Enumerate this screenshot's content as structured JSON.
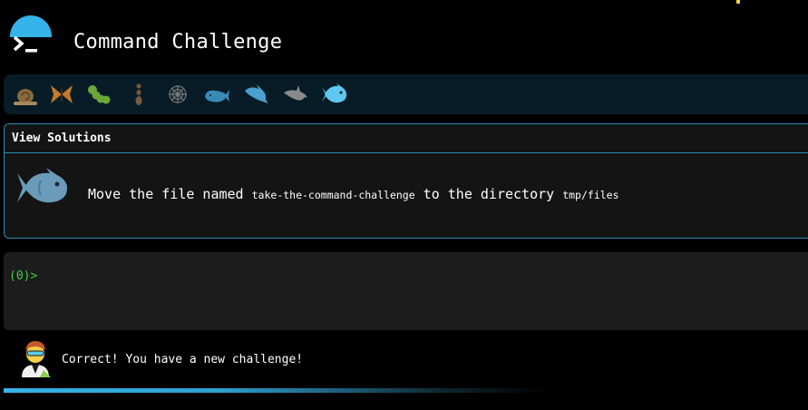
{
  "app": {
    "title": "Command Challenge"
  },
  "levels": [
    {
      "name": "snail-icon",
      "color": "#8a6a3a"
    },
    {
      "name": "butterfly-icon",
      "color": "#c47a2a"
    },
    {
      "name": "caterpillar-icon",
      "color": "#6aa83a"
    },
    {
      "name": "ant-icon",
      "color": "#7a5a3a"
    },
    {
      "name": "spiderweb-icon",
      "color": "#777777"
    },
    {
      "name": "whale-icon",
      "color": "#3a8ab8"
    },
    {
      "name": "dolphin-icon",
      "color": "#4aa0d0"
    },
    {
      "name": "dolphin-grey-icon",
      "color": "#8a8a8a"
    },
    {
      "name": "fish-icon",
      "color": "#5ec8f0"
    }
  ],
  "card": {
    "view_solutions": "View Solutions",
    "challenge": {
      "prefix": "Move the file named",
      "filename": "take-the-command-challenge",
      "middle": "to the directory",
      "directory": "tmp/files"
    }
  },
  "terminal": {
    "prompt": "(0)>"
  },
  "message": {
    "text": "Correct! You have a new challenge!"
  },
  "colors": {
    "accent": "#36b3e8",
    "prompt_green": "#3bd23b",
    "border": "#2a8fb8"
  },
  "progress": {
    "fraction": 0.66
  }
}
